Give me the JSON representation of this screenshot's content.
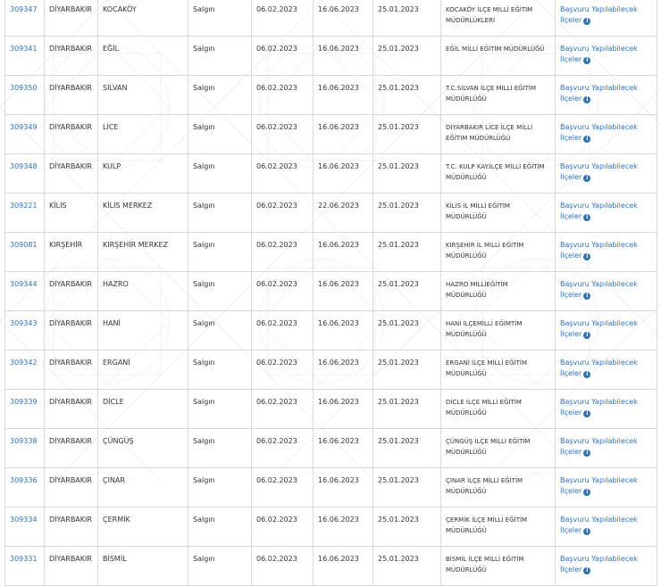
{
  "info_icon_glyph": "i",
  "link_color": "#2e73b8",
  "rows": [
    {
      "id": "309347",
      "il": "DİYARBAKIR",
      "ilce": "KOCAKÖY",
      "tur": "Salgın",
      "d1": "06.02.2023",
      "d2": "16.06.2023",
      "d3": "25.01.2023",
      "kurum": "KOCAKÖY İLÇE MİLLİ EĞİTİM MÜDÜRLÜKLERİ",
      "link1": "Başvuru Yapılabilecek",
      "link2": "İlçeler"
    },
    {
      "id": "309341",
      "il": "DİYARBAKIR",
      "ilce": "EĞİL",
      "tur": "Salgın",
      "d1": "06.02.2023",
      "d2": "16.06.2023",
      "d3": "25.01.2023",
      "kurum": "EĞİL MİLLİ EĞİTİM MÜDÜRLÜĞÜ",
      "link1": "Başvuru Yapılabilecek",
      "link2": "İlçeler"
    },
    {
      "id": "309350",
      "il": "DİYARBAKIR",
      "ilce": "SİLVAN",
      "tur": "Salgın",
      "d1": "06.02.2023",
      "d2": "16.06.2023",
      "d3": "25.01.2023",
      "kurum": "T.C.SİLVAN İLÇE MİLLİ EĞİTİM MÜDÜRLÜĞÜ",
      "link1": "Başvuru Yapılabilecek",
      "link2": "İlçeler"
    },
    {
      "id": "309349",
      "il": "DİYARBAKIR",
      "ilce": "LİCE",
      "tur": "Salgın",
      "d1": "06.02.2023",
      "d2": "16.06.2023",
      "d3": "25.01.2023",
      "kurum": "DİYARBAKIR LİCE İLÇE MİLLİ EĞİTİM MÜDÜRLÜĞÜ",
      "link1": "Başvuru Yapılabilecek",
      "link2": "İlçeler"
    },
    {
      "id": "309348",
      "il": "DİYARBAKIR",
      "ilce": "KULP",
      "tur": "Salgın",
      "d1": "06.02.2023",
      "d2": "16.06.2023",
      "d3": "25.01.2023",
      "kurum": "T.C. KULP KAY.İLÇE MİLLİ EĞİTİM MÜDÜRLÜĞÜ",
      "link1": "Başvuru Yapılabilecek",
      "link2": "İlçeler"
    },
    {
      "id": "309221",
      "il": "KİLİS",
      "ilce": "KİLİS MERKEZ",
      "tur": "Salgın",
      "d1": "06.02.2023",
      "d2": "22.06.2023",
      "d3": "25.01.2023",
      "kurum": "KİLİS İL MİLLİ EĞİTİM MÜDÜRLÜĞÜ",
      "link1": "Başvuru Yapılabilecek",
      "link2": "İlçeler"
    },
    {
      "id": "309081",
      "il": "KIRŞEHİR",
      "ilce": "KIRŞEHİR MERKEZ",
      "tur": "Salgın",
      "d1": "06.02.2023",
      "d2": "16.06.2023",
      "d3": "25.01.2023",
      "kurum": "KIRŞEHİR İL MİLLİ EĞİTİM MÜDÜRLÜĞÜ",
      "link1": "Başvuru Yapılabilecek",
      "link2": "İlçeler"
    },
    {
      "id": "309344",
      "il": "DİYARBAKIR",
      "ilce": "HAZRO",
      "tur": "Salgın",
      "d1": "06.02.2023",
      "d2": "16.06.2023",
      "d3": "25.01.2023",
      "kurum": "HAZRO MİLLİEĞİTİM MÜDÜRLÜĞÜ",
      "link1": "Başvuru Yapılabilecek",
      "link2": "İlçeler"
    },
    {
      "id": "309343",
      "il": "DİYARBAKIR",
      "ilce": "HANİ",
      "tur": "Salgın",
      "d1": "06.02.2023",
      "d2": "16.06.2023",
      "d3": "25.01.2023",
      "kurum": "HANİ İLÇEMİLLİ EĞİMTİM MÜDÜRLÜĞÜ",
      "link1": "Başvuru Yapılabilecek",
      "link2": "İlçeler"
    },
    {
      "id": "309342",
      "il": "DİYARBAKIR",
      "ilce": "ERGANİ",
      "tur": "Salgın",
      "d1": "06.02.2023",
      "d2": "16.06.2023",
      "d3": "25.01.2023",
      "kurum": "ERGANİ İLÇE MİLLİ EĞİTİM MÜDÜRLÜĞÜ",
      "link1": "Başvuru Yapılabilecek",
      "link2": "İlçeler"
    },
    {
      "id": "309339",
      "il": "DİYARBAKIR",
      "ilce": "DİCLE",
      "tur": "Salgın",
      "d1": "06.02.2023",
      "d2": "16.06.2023",
      "d3": "25.01.2023",
      "kurum": "DİCLE İLÇE MİLLİ EĞİTİM MÜDÜRLÜĞÜ",
      "link1": "Başvuru Yapılabilecek",
      "link2": "İlçeler"
    },
    {
      "id": "309338",
      "il": "DİYARBAKIR",
      "ilce": "ÇÜNGÜŞ",
      "tur": "Salgın",
      "d1": "06.02.2023",
      "d2": "16.06.2023",
      "d3": "25.01.2023",
      "kurum": "ÇÜNGÜŞ İLÇE MİLLİ EĞİTİM MÜDÜRLÜĞÜ",
      "link1": "Başvuru Yapılabilecek",
      "link2": "İlçeler"
    },
    {
      "id": "309336",
      "il": "DİYARBAKIR",
      "ilce": "ÇINAR",
      "tur": "Salgın",
      "d1": "06.02.2023",
      "d2": "16.06.2023",
      "d3": "25.01.2023",
      "kurum": "ÇINAR İLÇE MİLLİ EĞİTİM MÜDÜRLÜĞÜ",
      "link1": "Başvuru Yapılabilecek",
      "link2": "İlçeler"
    },
    {
      "id": "309334",
      "il": "DİYARBAKIR",
      "ilce": "ÇERMİK",
      "tur": "Salgın",
      "d1": "06.02.2023",
      "d2": "16.06.2023",
      "d3": "25.01.2023",
      "kurum": "ÇERMİK İLÇE MİLLİ EĞİTİM MÜDÜRLÜĞÜ",
      "link1": "Başvuru Yapılabilecek",
      "link2": "İlçeler"
    },
    {
      "id": "309331",
      "il": "DİYARBAKIR",
      "ilce": "BİSMİL",
      "tur": "Salgın",
      "d1": "06.02.2023",
      "d2": "16.06.2023",
      "d3": "25.01.2023",
      "kurum": "BİSMİL İLÇE MİLLİ EĞİTİM MÜDÜRLÜĞÜ",
      "link1": "Başvuru Yapılabilecek",
      "link2": "İlçeler"
    }
  ]
}
